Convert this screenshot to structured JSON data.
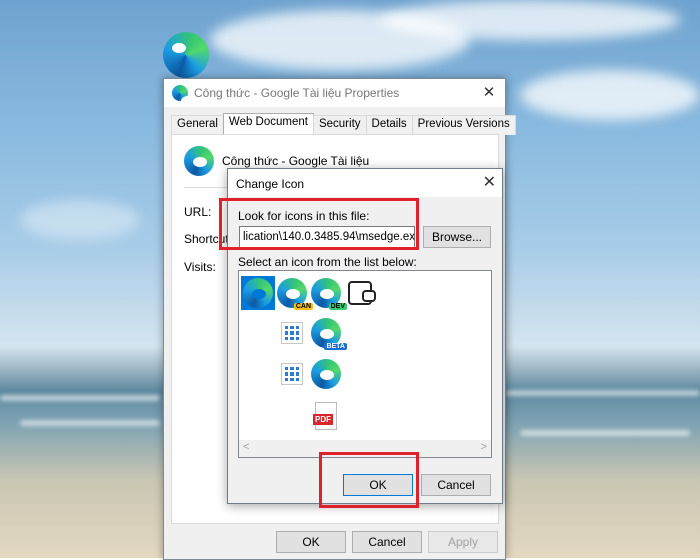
{
  "properties_window": {
    "title": "Công thức - Google Tài liệu Properties",
    "tabs": [
      "General",
      "Web Document",
      "Security",
      "Details",
      "Previous Versions"
    ],
    "active_tab": "Web Document",
    "shortcut_name": "Công thức - Google Tài liệu",
    "labels": {
      "url": "URL:",
      "shortcut_key": "Shortcut k",
      "visits": "Visits:"
    },
    "buttons": {
      "ok": "OK",
      "cancel": "Cancel",
      "apply": "Apply"
    }
  },
  "change_icon_dialog": {
    "title": "Change Icon",
    "file_label": "Look for icons in this file:",
    "file_path": "lication\\140.0.3485.94\\msedge.exe",
    "browse_label": "Browse...",
    "list_label": "Select an icon from the list below:",
    "icons": [
      {
        "name": "edge-icon",
        "selected": true
      },
      {
        "name": "edge-canary-icon",
        "badge": "CAN",
        "badge_color": "#f2c01d"
      },
      {
        "name": "edge-dev-icon",
        "badge": "DEV",
        "badge_color": "#37c871"
      },
      {
        "name": "wallet-icon"
      },
      {
        "name": "app-grid-icon"
      },
      {
        "name": "edge-beta-icon",
        "badge": "BETA",
        "badge_color": "#1b6fd1"
      },
      {
        "name": "app-grid-icon"
      },
      {
        "name": "edge-icon"
      },
      {
        "name": "pdf-icon",
        "badge": "PDF"
      }
    ],
    "buttons": {
      "ok": "OK",
      "cancel": "Cancel"
    }
  },
  "colors": {
    "highlight_red": "#e0202a",
    "selection_blue": "#0078d7"
  }
}
